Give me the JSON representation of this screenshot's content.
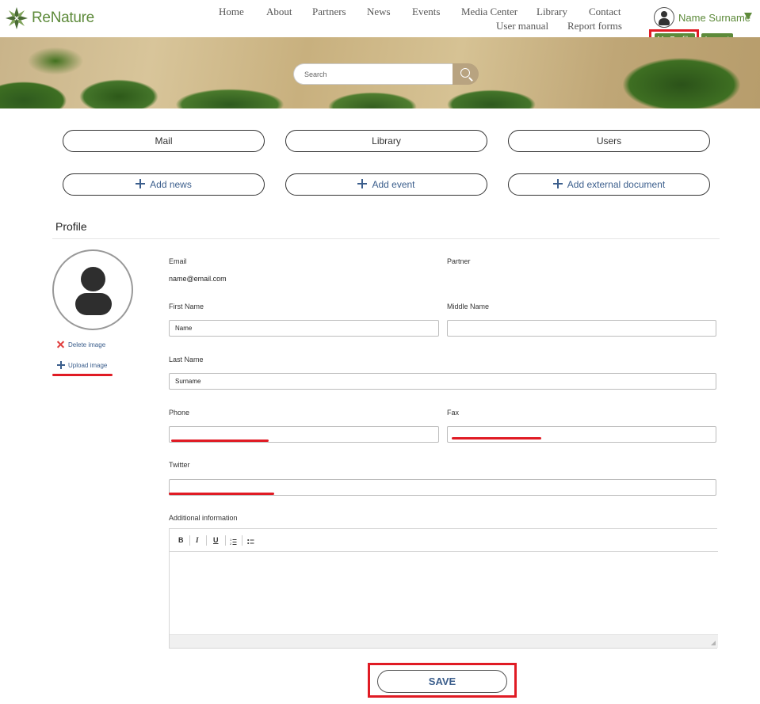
{
  "brand": {
    "name": "ReNature"
  },
  "nav": {
    "row1": [
      "Home",
      "About",
      "Partners",
      "News",
      "Events",
      "Media Center",
      "Library",
      "Contact"
    ],
    "row2": [
      "User manual",
      "Report forms"
    ]
  },
  "user": {
    "name": "Name Surname",
    "my_profile": "My Profile",
    "logout": "Logout"
  },
  "search": {
    "placeholder": "Search"
  },
  "quick_actions": [
    "Mail",
    "Library",
    "Users"
  ],
  "add_actions": [
    "Add news",
    "Add event",
    "Add external document"
  ],
  "profile": {
    "title": "Profile",
    "delete_image": "Delete image",
    "upload_image": "Upload image",
    "email_label": "Email",
    "email_value": "name@email.com",
    "partner_label": "Partner",
    "first_name_label": "First Name",
    "first_name_value": "Name",
    "middle_name_label": "Middle Name",
    "middle_name_value": "",
    "last_name_label": "Last Name",
    "last_name_value": "Surname",
    "phone_label": "Phone",
    "phone_value": "",
    "fax_label": "Fax",
    "fax_value": "",
    "twitter_label": "Twitter",
    "twitter_value": "",
    "additional_label": "Additional information",
    "toolbar": {
      "bold": "B",
      "italic": "I",
      "underline": "U"
    },
    "save": "SAVE"
  },
  "colors": {
    "brand_green": "#5d8a3a",
    "link_blue": "#3b5e8c",
    "annotation_red": "#e01b24"
  }
}
